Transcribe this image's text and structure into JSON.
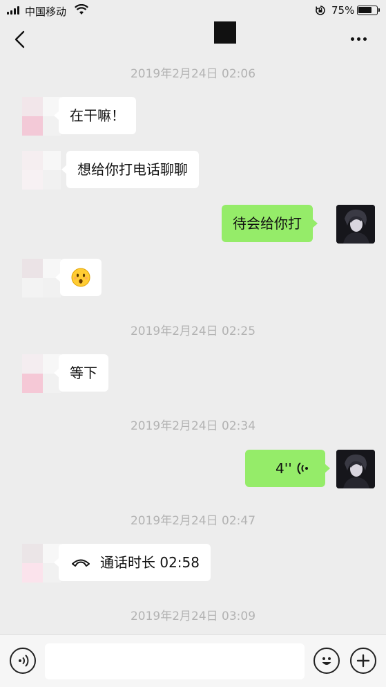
{
  "status_bar": {
    "carrier": "中国移动",
    "battery_percent": "75%",
    "battery_level": 0.75
  },
  "header": {
    "back_icon": "chevron-left-icon",
    "more_icon": "more-dots-icon"
  },
  "messages": [
    {
      "type": "timestamp",
      "text": "2019年2月24日 02:06"
    },
    {
      "type": "text",
      "side": "left",
      "text": "在干嘛！"
    },
    {
      "type": "text",
      "side": "left",
      "text": "想给你打电话聊聊"
    },
    {
      "type": "text",
      "side": "right",
      "text": "待会给你打"
    },
    {
      "type": "emoji",
      "side": "left",
      "emoji": "hushed-face-emoji"
    },
    {
      "type": "timestamp",
      "text": "2019年2月24日 02:25"
    },
    {
      "type": "text",
      "side": "left",
      "text": "等下"
    },
    {
      "type": "timestamp",
      "text": "2019年2月24日 02:34"
    },
    {
      "type": "voice",
      "side": "right",
      "duration": "4''"
    },
    {
      "type": "timestamp",
      "text": "2019年2月24日 02:47"
    },
    {
      "type": "call",
      "side": "left",
      "text": "通话时长 02:58"
    },
    {
      "type": "timestamp",
      "text": "2019年2月24日 03:09"
    }
  ],
  "input_bar": {
    "voice_icon": "voice-input-icon",
    "emoji_icon": "smiley-icon",
    "add_icon": "plus-icon",
    "input_value": ""
  },
  "colors": {
    "background": "#ededed",
    "outgoing_bubble": "#95ec69",
    "incoming_bubble": "#ffffff",
    "timestamp": "#b3b3b3"
  }
}
